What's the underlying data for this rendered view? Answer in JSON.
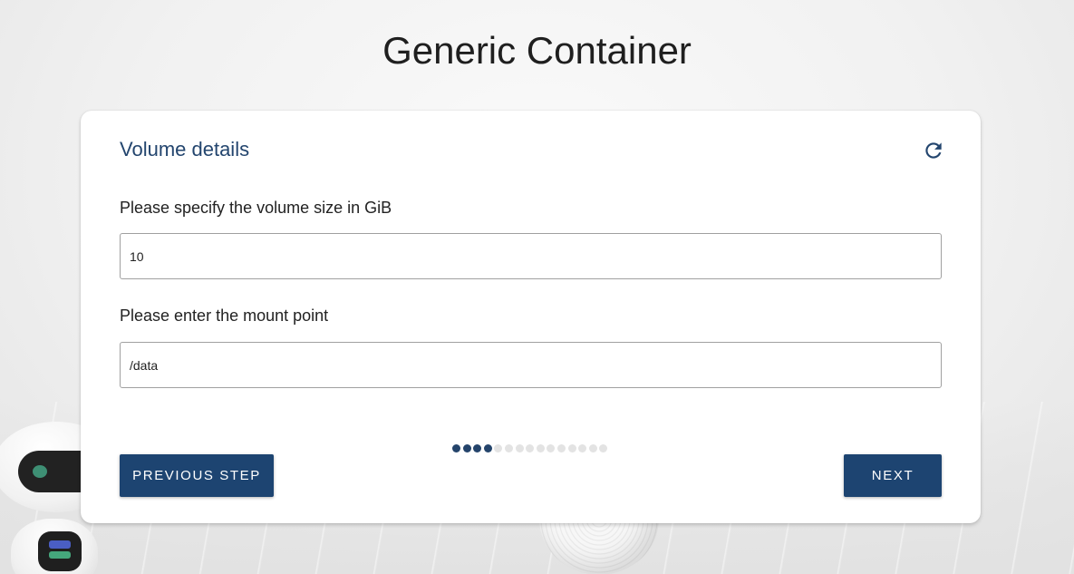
{
  "header": {
    "title": "Generic Container"
  },
  "card": {
    "title": "Volume details",
    "refresh_icon": "refresh-icon",
    "fields": [
      {
        "label": "Please specify the volume size in GiB",
        "value": "10"
      },
      {
        "label": "Please enter the mount point",
        "value": "/data"
      }
    ],
    "progress": {
      "current_step": 4,
      "total_steps": 15
    },
    "buttons": {
      "previous_label": "PREVIOUS STEP",
      "next_label": "NEXT"
    }
  },
  "colors": {
    "primary": "#1d4471",
    "title_blue": "#23456e",
    "dot_inactive": "#e3e3e3"
  }
}
